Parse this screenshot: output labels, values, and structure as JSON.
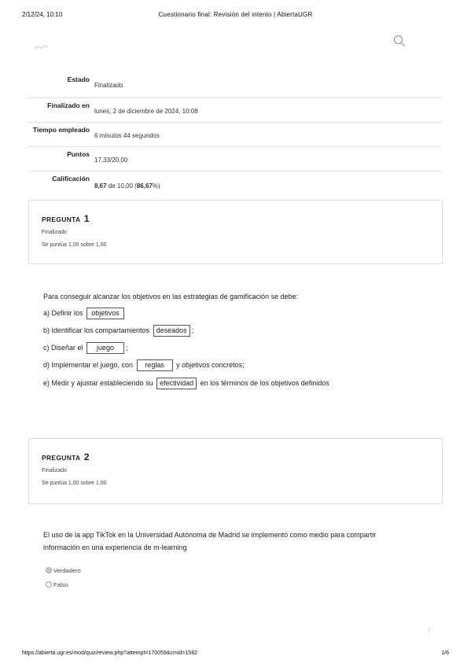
{
  "print_header": {
    "date": "2/12/24, 10:10",
    "title": "Cuestionario final: Revisión del intento | AbiertaUGR"
  },
  "summary": [
    {
      "label": "Estado",
      "value": "Finalizado"
    },
    {
      "label": "Finalizado en",
      "value": "lunes, 2 de diciembre de 2024, 10:08"
    },
    {
      "label": "Tiempo empleado",
      "value": "6 minutos 44 segundos"
    },
    {
      "label": "Puntos",
      "value": "17,33/20,00"
    },
    {
      "label": "Calificación",
      "grade_bold": "8,67",
      "grade_mid": " de 10,00 (",
      "grade_pct": "86,67",
      "grade_end": "%)"
    }
  ],
  "q1": {
    "label": "PREGUNTA",
    "number": "1",
    "state": "Finalizado",
    "grade": "Se puntúa 1,00 sobre 1,00",
    "text": "Para conseguir alcanzar los objetivos en las estrategias de gamificación se debe:",
    "items": [
      {
        "pre": "a) Definir los",
        "ans": "objetivos",
        "post": ""
      },
      {
        "pre": "b) Identificar los compartamientos",
        "ans": "deseados",
        "post": ";"
      },
      {
        "pre": "c) Diseñar el",
        "ans": "juego",
        "post": ";"
      },
      {
        "pre": "d) Implementar el juego, con",
        "ans": "reglas",
        "post": "y objetivos concretos;"
      },
      {
        "pre": "e) Medir y ajustar estableciendo su",
        "ans": "efectividad",
        "post": "en los términos de los objetivos definidos"
      }
    ]
  },
  "q2": {
    "label": "PREGUNTA",
    "number": "2",
    "state": "Finalizado",
    "grade": "Se puntúa 1,00 sobre 1,00",
    "text_line1": "El uso de la app TikTok en la Universidad Autónoma de Madrid se implementó como medio para compartir",
    "text_line2": "información en una experiencia de m-learning",
    "options": [
      {
        "label": "Verdadero",
        "checked": true
      },
      {
        "label": "Falso",
        "checked": false
      }
    ]
  },
  "footer": {
    "url": "https://abierta.ugr.es/mod/quiz/review.php?attempt=170059&cmid=1582",
    "page": "1/6"
  },
  "icons": {
    "search": "search-icon",
    "logo": "site-logo",
    "back_to_top": "arrow-up-icon"
  }
}
